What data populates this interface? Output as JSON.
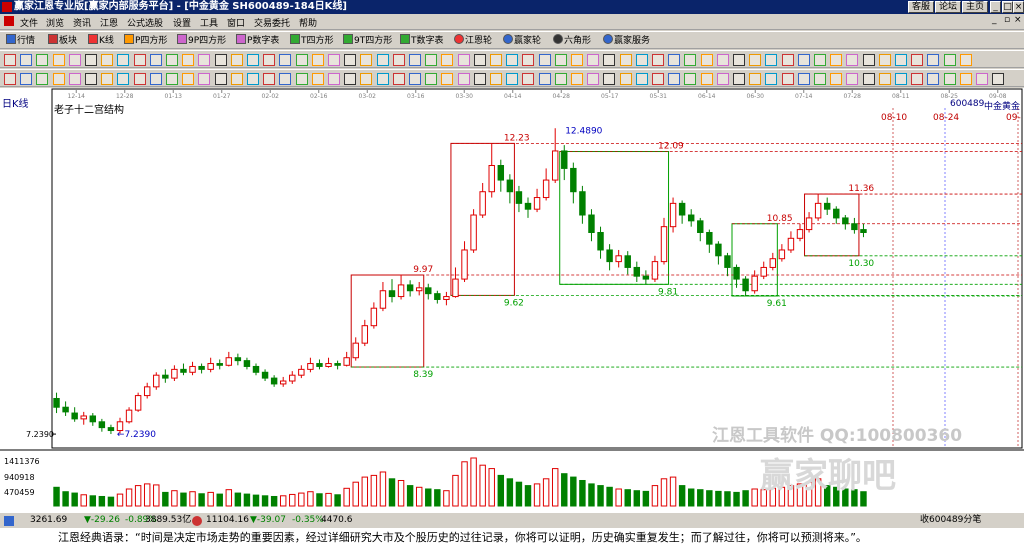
{
  "window": {
    "title": "赢家江恩专业版[赢家内部服务平台] - [中金黄金  SH600489-184日K线]",
    "buttons": [
      "客服",
      "论坛",
      "主页"
    ]
  },
  "menu": [
    "文件",
    "浏览",
    "资讯",
    "江恩",
    "公式选股",
    "设置",
    "工具",
    "窗口",
    "交易委托",
    "帮助"
  ],
  "toolbar1": [
    "行情",
    "板块",
    "K线",
    "P四方形",
    "9P四方形",
    "P数字表",
    "T四方形",
    "9T四方形",
    "T数字表",
    "江恩轮",
    "赢家轮",
    "六角形",
    "赢家服务"
  ],
  "chart_header": {
    "period": "日K线",
    "indicator": "老子十二宫结构",
    "code": "600489",
    "name": "中金黄金",
    "watermark1": "江恩工具软件  QQ:100800360",
    "watermark2": "赢家聊吧",
    "low_marker": "7.2390",
    "high_marker": "12.4890"
  },
  "colors": {
    "up": "#e00000",
    "down": "#008000",
    "box_red": "#c80000",
    "box_green": "#00a000",
    "axis": "#000000",
    "grid": "#c0c0c0"
  },
  "chart_data": {
    "type": "candlestick",
    "x_ticks": [
      "12-14",
      "12-28",
      "01-13",
      "01-27",
      "02-02",
      "02-16",
      "03-02",
      "03-16",
      "03-30",
      "04-14",
      "04-28",
      "05-17",
      "05-31",
      "06-14",
      "06-30",
      "07-14",
      "07-28",
      "08-11",
      "08-25",
      "09-08"
    ],
    "future_date_labels": [
      "08-10",
      "08-24",
      "09-"
    ],
    "y_axis_labels": [
      "7.2390"
    ],
    "volume_axis_labels": [
      "1411376",
      "940918",
      "470459"
    ],
    "ylim": [
      7.0,
      12.7
    ],
    "price_levels": [
      {
        "label": "9.97",
        "value": 9.97
      },
      {
        "label": "8.39",
        "value": 8.39
      },
      {
        "label": "12.23",
        "value": 12.23
      },
      {
        "label": "9.62",
        "value": 9.62
      },
      {
        "label": "12.09",
        "value": 12.09
      },
      {
        "label": "9.81",
        "value": 9.81
      },
      {
        "label": "10.85",
        "value": 10.85
      },
      {
        "label": "9.61",
        "value": 9.61
      },
      {
        "label": "11.36",
        "value": 11.36
      },
      {
        "label": "10.30",
        "value": 10.3
      }
    ],
    "candles": [
      [
        7.85,
        7.7,
        7.95,
        7.6,
        550000
      ],
      [
        7.7,
        7.62,
        7.8,
        7.55,
        420000
      ],
      [
        7.6,
        7.5,
        7.7,
        7.45,
        380000
      ],
      [
        7.5,
        7.55,
        7.62,
        7.4,
        330000
      ],
      [
        7.55,
        7.45,
        7.6,
        7.38,
        300000
      ],
      [
        7.45,
        7.35,
        7.5,
        7.28,
        280000
      ],
      [
        7.35,
        7.3,
        7.4,
        7.24,
        260000
      ],
      [
        7.3,
        7.45,
        7.52,
        7.25,
        350000
      ],
      [
        7.45,
        7.65,
        7.7,
        7.42,
        500000
      ],
      [
        7.65,
        7.9,
        7.95,
        7.62,
        600000
      ],
      [
        7.9,
        8.05,
        8.12,
        7.85,
        650000
      ],
      [
        8.05,
        8.25,
        8.3,
        8.0,
        620000
      ],
      [
        8.25,
        8.2,
        8.35,
        8.12,
        400000
      ],
      [
        8.2,
        8.35,
        8.42,
        8.15,
        450000
      ],
      [
        8.35,
        8.3,
        8.45,
        8.25,
        380000
      ],
      [
        8.3,
        8.4,
        8.48,
        8.25,
        420000
      ],
      [
        8.4,
        8.35,
        8.45,
        8.28,
        360000
      ],
      [
        8.35,
        8.45,
        8.55,
        8.3,
        400000
      ],
      [
        8.45,
        8.42,
        8.52,
        8.35,
        350000
      ],
      [
        8.42,
        8.55,
        8.65,
        8.4,
        480000
      ],
      [
        8.55,
        8.5,
        8.62,
        8.42,
        380000
      ],
      [
        8.5,
        8.4,
        8.55,
        8.35,
        350000
      ],
      [
        8.4,
        8.3,
        8.45,
        8.25,
        320000
      ],
      [
        8.3,
        8.2,
        8.35,
        8.15,
        300000
      ],
      [
        8.2,
        8.1,
        8.25,
        8.05,
        280000
      ],
      [
        8.1,
        8.15,
        8.22,
        8.05,
        300000
      ],
      [
        8.15,
        8.25,
        8.32,
        8.1,
        340000
      ],
      [
        8.25,
        8.35,
        8.42,
        8.2,
        380000
      ],
      [
        8.35,
        8.45,
        8.55,
        8.3,
        420000
      ],
      [
        8.45,
        8.4,
        8.52,
        8.35,
        360000
      ],
      [
        8.4,
        8.45,
        8.55,
        8.38,
        370000
      ],
      [
        8.45,
        8.42,
        8.5,
        8.35,
        330000
      ],
      [
        8.42,
        8.55,
        8.65,
        8.4,
        520000
      ],
      [
        8.55,
        8.8,
        8.9,
        8.5,
        700000
      ],
      [
        8.8,
        9.1,
        9.2,
        8.75,
        850000
      ],
      [
        9.1,
        9.4,
        9.5,
        9.05,
        900000
      ],
      [
        9.4,
        9.7,
        9.85,
        9.35,
        1000000
      ],
      [
        9.7,
        9.6,
        9.9,
        9.5,
        800000
      ],
      [
        9.6,
        9.8,
        9.97,
        9.55,
        750000
      ],
      [
        9.8,
        9.7,
        9.88,
        9.6,
        600000
      ],
      [
        9.7,
        9.75,
        9.85,
        9.62,
        550000
      ],
      [
        9.75,
        9.65,
        9.82,
        9.55,
        500000
      ],
      [
        9.65,
        9.55,
        9.7,
        9.48,
        480000
      ],
      [
        9.55,
        9.6,
        9.68,
        9.45,
        450000
      ],
      [
        9.6,
        9.9,
        10.1,
        9.58,
        900000
      ],
      [
        9.9,
        10.4,
        10.55,
        9.85,
        1300000
      ],
      [
        10.4,
        11.0,
        11.1,
        10.35,
        1411376
      ],
      [
        11.0,
        11.4,
        11.55,
        10.95,
        1200000
      ],
      [
        11.4,
        11.85,
        12.23,
        11.3,
        1100000
      ],
      [
        11.85,
        11.6,
        11.95,
        11.4,
        900000
      ],
      [
        11.6,
        11.4,
        11.7,
        11.2,
        800000
      ],
      [
        11.4,
        11.2,
        11.5,
        11.05,
        700000
      ],
      [
        11.2,
        11.1,
        11.3,
        10.95,
        600000
      ],
      [
        11.1,
        11.3,
        11.45,
        11.05,
        650000
      ],
      [
        11.3,
        11.6,
        11.8,
        11.25,
        800000
      ],
      [
        11.6,
        12.1,
        12.49,
        11.55,
        1100000
      ],
      [
        12.1,
        11.8,
        12.2,
        11.6,
        950000
      ],
      [
        11.8,
        11.4,
        11.9,
        11.2,
        850000
      ],
      [
        11.4,
        11.0,
        11.5,
        10.85,
        750000
      ],
      [
        11.0,
        10.7,
        11.1,
        10.55,
        650000
      ],
      [
        10.7,
        10.4,
        10.8,
        10.25,
        600000
      ],
      [
        10.4,
        10.2,
        10.5,
        10.05,
        550000
      ],
      [
        10.2,
        10.3,
        10.4,
        10.1,
        500000
      ],
      [
        10.3,
        10.1,
        10.38,
        9.98,
        480000
      ],
      [
        10.1,
        9.95,
        10.2,
        9.85,
        450000
      ],
      [
        9.95,
        9.9,
        10.05,
        9.81,
        430000
      ],
      [
        9.9,
        10.2,
        10.3,
        9.85,
        600000
      ],
      [
        10.2,
        10.8,
        10.95,
        10.15,
        800000
      ],
      [
        10.8,
        11.2,
        11.3,
        10.7,
        850000
      ],
      [
        11.2,
        11.0,
        11.25,
        10.85,
        600000
      ],
      [
        11.0,
        10.9,
        11.1,
        10.8,
        500000
      ],
      [
        10.9,
        10.7,
        10.95,
        10.55,
        480000
      ],
      [
        10.7,
        10.5,
        10.75,
        10.35,
        450000
      ],
      [
        10.5,
        10.3,
        10.55,
        10.15,
        430000
      ],
      [
        10.3,
        10.1,
        10.35,
        9.95,
        420000
      ],
      [
        10.1,
        9.9,
        10.15,
        9.75,
        400000
      ],
      [
        9.9,
        9.7,
        9.95,
        9.61,
        450000
      ],
      [
        9.7,
        9.95,
        10.05,
        9.65,
        500000
      ],
      [
        9.95,
        10.1,
        10.2,
        9.9,
        480000
      ],
      [
        10.1,
        10.25,
        10.35,
        10.05,
        520000
      ],
      [
        10.25,
        10.4,
        10.5,
        10.2,
        550000
      ],
      [
        10.4,
        10.6,
        10.72,
        10.35,
        600000
      ],
      [
        10.6,
        10.75,
        10.85,
        10.55,
        650000
      ],
      [
        10.75,
        10.95,
        11.05,
        10.7,
        700000
      ],
      [
        10.95,
        11.2,
        11.36,
        10.9,
        800000
      ],
      [
        11.2,
        11.1,
        11.3,
        11.0,
        600000
      ],
      [
        11.1,
        10.95,
        11.15,
        10.85,
        550000
      ],
      [
        10.95,
        10.85,
        11.0,
        10.75,
        500000
      ],
      [
        10.85,
        10.75,
        10.95,
        10.68,
        480000
      ],
      [
        10.75,
        10.7,
        10.85,
        10.62,
        420000
      ]
    ]
  },
  "status": {
    "sh_index": "3261.69",
    "sh_change": "▼-29.26",
    "sh_pct": "-0.89%",
    "sh_amount": "3889.53亿",
    "sz_index": "11104.16",
    "sz_change": "▼-39.07",
    "sz_pct": "-0.35%",
    "sz_amount": "4470.6",
    "right": "收600489分笔"
  },
  "quote": "江恩经典语录：“时间是决定市场走势的重要因素，经过详细研究大市及个股历史的过往记录，你将可以证明，历史确实重复发生；而了解过往，你将可以预测将来。”。"
}
